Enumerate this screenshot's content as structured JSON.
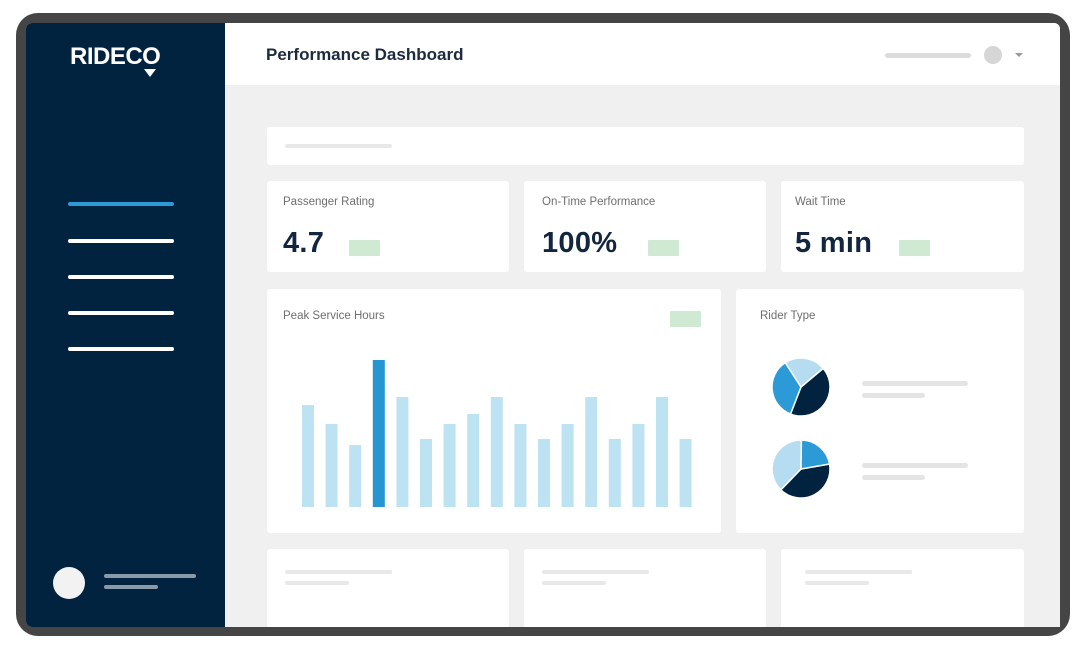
{
  "brand": {
    "logo_text": "RIDECO"
  },
  "header": {
    "title": "Performance Dashboard"
  },
  "metrics": [
    {
      "label": "Passenger Rating",
      "value": "4.7"
    },
    {
      "label": "On-Time Performance",
      "value": "100%"
    },
    {
      "label": "Wait Time",
      "value": "5 min"
    }
  ],
  "peak_chart": {
    "title": "Peak Service Hours"
  },
  "rider_type": {
    "title": "Rider Type"
  },
  "colors": {
    "sidebar": "#01233f",
    "accent": "#2b9ad6",
    "bar_light": "#bde2f2",
    "bar_highlight": "#2596cf",
    "badge_green": "#cfe9d2",
    "pie_dark": "#01233f",
    "pie_mid": "#2b9ad6",
    "pie_light": "#b5dcf1"
  },
  "chart_data": {
    "type": "bar",
    "title": "Peak Service Hours",
    "xlabel": "",
    "ylabel": "",
    "categories": [],
    "values": [
      102,
      83,
      62,
      147,
      110,
      68,
      83,
      93,
      110,
      83,
      68,
      83,
      110,
      68,
      83,
      110,
      68
    ],
    "highlight_index": 3,
    "ylim": [
      0,
      150
    ],
    "grid": false
  },
  "pies": [
    {
      "name": "",
      "slices": [
        42,
        35,
        23
      ]
    },
    {
      "name": "",
      "slices": [
        40,
        38,
        22
      ]
    }
  ]
}
